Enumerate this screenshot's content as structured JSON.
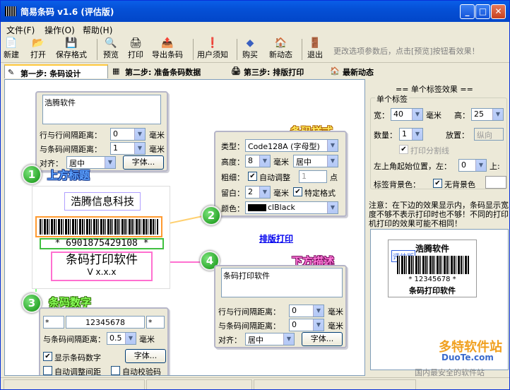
{
  "window": {
    "title": "简易条码 v1.6 (评估版)",
    "min": "_",
    "max": "□",
    "close": "✕"
  },
  "menu": [
    {
      "label": "文件(F)"
    },
    {
      "label": "操作(O)"
    },
    {
      "label": "帮助(H)"
    }
  ],
  "toolbar": {
    "items": [
      {
        "label": "新建",
        "icon": "📄"
      },
      {
        "label": "打开",
        "icon": "📂"
      },
      {
        "label": "保存格式",
        "icon": "💾"
      },
      {
        "label": "预览",
        "icon": "🔍"
      },
      {
        "label": "打印",
        "icon": "🖨"
      },
      {
        "label": "导出条码",
        "icon": "📤"
      },
      {
        "label": "用户须知",
        "icon": "❗"
      },
      {
        "label": "购买",
        "icon": "◆"
      },
      {
        "label": "新动态",
        "icon": "🏠"
      },
      {
        "label": "退出",
        "icon": "🚪"
      }
    ],
    "hint": "更改选项参数后，点击[预览]按钮看效果！"
  },
  "tabs": [
    {
      "label": "第一步: 条码设计",
      "icon": "✎"
    },
    {
      "label": "第二步: 准备条码数据",
      "icon": "▦"
    },
    {
      "label": "第三步: 排版打印",
      "icon": "🖨"
    },
    {
      "label": "最新动态",
      "icon": "🏠"
    }
  ],
  "top_title": {
    "textarea": "浩腾软件",
    "line_gap_label": "行与行间隔距离：",
    "line_gap": "0",
    "bar_gap_label": "与条码间隔距离：",
    "bar_gap": "1",
    "align_label": "对齐：",
    "align": "居中",
    "font_btn": "字体...",
    "unit": "毫米"
  },
  "barcode_style": {
    "heading": "条码样式",
    "type_label": "类型：",
    "type": "Code128A (字母型)",
    "height_label": "高度：",
    "height": "8",
    "height_unit": "毫米",
    "height_align": "居中",
    "thickness_label": "粗细：",
    "auto_adjust": "自动调整",
    "thick_value": "1",
    "thick_unit": "点",
    "margin_label": "留白：",
    "margin": "2",
    "margin_unit": "毫米",
    "special": "特定格式",
    "color_label": "颜色：",
    "color": "clBlack"
  },
  "canvas": {
    "label_top": "上方标题",
    "label_barcode_digits": "条码数字",
    "label_bottom": "下方描述",
    "company": "浩腾信息科技",
    "digits": "* 6901875429108 *",
    "product": "条码打印软件",
    "version": "V x.x.x",
    "print_link": "排版打印",
    "num1": "1",
    "num2": "2",
    "num3": "3",
    "num4": "4"
  },
  "barcode_digits": {
    "prefix": "*",
    "value": "12345678",
    "suffix": "*",
    "gap_label": "与条码间隔距离：",
    "gap": "0.5",
    "unit": "毫米",
    "show_digits": "显示条码数字",
    "font_btn": "字体...",
    "auto_gap": "自动调整间距",
    "auto_check": "自动校验码"
  },
  "bottom_desc": {
    "textarea": "条码打印软件",
    "line_gap_label": "行与行间隔距离：",
    "line_gap": "0",
    "bar_gap_label": "与条码间隔距离：",
    "bar_gap": "0",
    "align_label": "对齐：",
    "align": "居中",
    "font_btn": "字体...",
    "unit": "毫米"
  },
  "single_label": {
    "header": "== 单个标签效果 ==",
    "group": "单个标签",
    "width_label": "宽：",
    "width": "40",
    "width_unit": "毫米",
    "height_label": "高：",
    "height": "25",
    "count_label": "数量：",
    "count": "1",
    "place_label": "放置：",
    "place": "纵向",
    "print_divider": "打印分割线",
    "pos_label": "左上角起始位置，左：",
    "pos_left": "0",
    "pos_top_label": "上:",
    "bg_label": "标签背景色：",
    "no_bg": "无背景色"
  },
  "notice": "注意：在下边的效果显示内，条码显示宽度不够不表示打印时也不够！不同的打印机打印的效果可能不相同！",
  "preview": {
    "title": "浩腾软件",
    "eval": "评估版",
    "digits": "* 12345678 *",
    "desc": "条码打印软件"
  },
  "watermark": {
    "brand": "多特软件站",
    "site": "DuoTe.com",
    "slogan": "国内最安全的软件站"
  }
}
